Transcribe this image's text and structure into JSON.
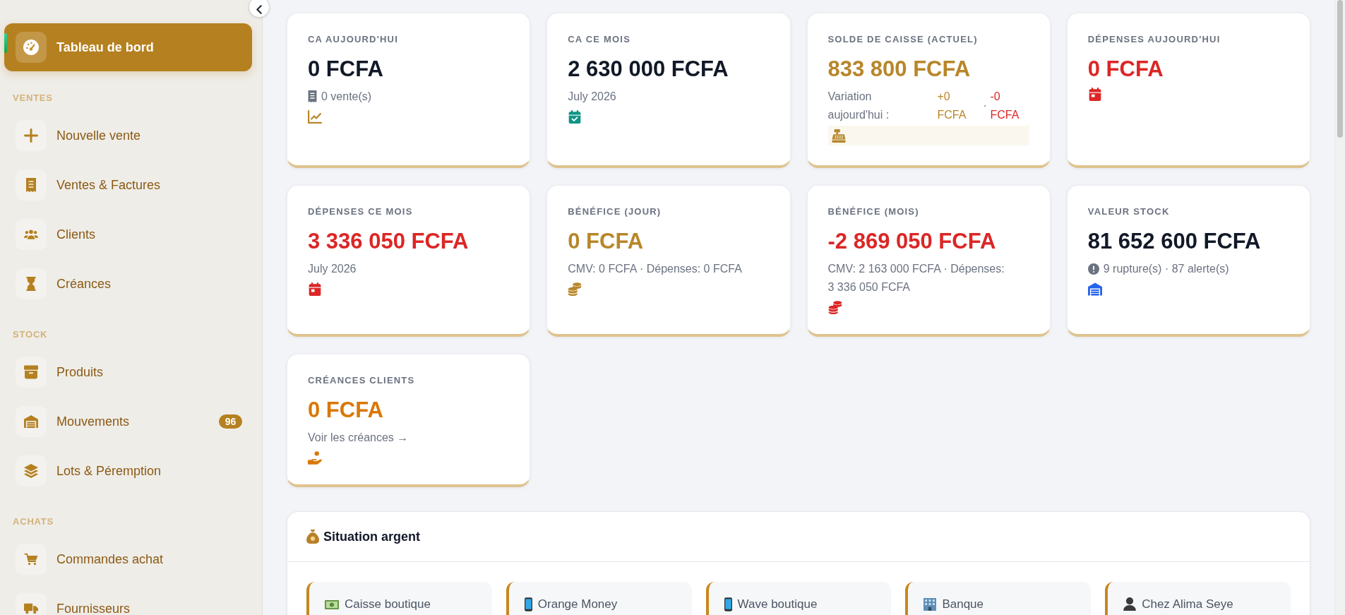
{
  "sidebar": {
    "sections": [
      {
        "items": [
          {
            "label": "Tableau de bord",
            "kind": "dashboard",
            "selected": true
          }
        ]
      },
      {
        "title": "VENTES",
        "items": [
          {
            "label": "Nouvelle vente",
            "kind": "add",
            "selected": false
          },
          {
            "label": "Ventes & Factures",
            "kind": "invoices",
            "selected": false
          },
          {
            "label": "Clients",
            "kind": "clients",
            "selected": false
          },
          {
            "label": "Créances",
            "kind": "debts",
            "selected": false
          }
        ]
      },
      {
        "title": "STOCK",
        "items": [
          {
            "label": "Produits",
            "kind": "products",
            "selected": false
          },
          {
            "label": "Mouvements",
            "kind": "movements",
            "selected": false,
            "badge": "96"
          },
          {
            "label": "Lots & Péremption",
            "kind": "batches",
            "selected": false
          }
        ]
      },
      {
        "title": "ACHATS",
        "items": [
          {
            "label": "Commandes achat",
            "kind": "orders",
            "selected": false
          },
          {
            "label": "Fournisseurs",
            "kind": "suppliers",
            "selected": false
          }
        ]
      }
    ]
  },
  "stats": [
    {
      "kind": "revenue",
      "label": "CA AUJOURD'HUI",
      "value": "0 FCFA",
      "color": "#111827",
      "note": "0 vente(s)"
    },
    {
      "kind": "period",
      "label": "CA CE MOIS",
      "value": "2 630 000 FCFA",
      "color": "#111827",
      "note": "July 2026"
    },
    {
      "kind": "cash",
      "label": "SOLDE DE CAISSE (ACTUEL)",
      "value": "833 800 FCFA",
      "color": "#b8862a",
      "variation": {
        "label": "Variation aujourd'hui :",
        "gain": "+0 FCFA",
        "separator": "·",
        "loss": "-0 FCFA"
      }
    },
    {
      "kind": "expense",
      "label": "DÉPENSES AUJOURD'HUI",
      "value": "0 FCFA",
      "color": "#dc2626"
    },
    {
      "kind": "expense",
      "label": "DÉPENSES CE MOIS",
      "value": "3 336 050 FCFA",
      "color": "#dc2626",
      "note": "July 2026"
    },
    {
      "kind": "profit",
      "label": "BÉNÉFICE (JOUR)",
      "value": "0 FCFA",
      "color": "#b8862a",
      "note": "CMV: 0 FCFA · Dépenses: 0 FCFA"
    },
    {
      "kind": "profit",
      "label": "BÉNÉFICE (MOIS)",
      "value": "-2 869 050 FCFA",
      "color": "#dc2626",
      "note": "CMV: 2 163 000 FCFA · Dépenses: 3 336 050 FCFA"
    },
    {
      "kind": "stock",
      "label": "VALEUR STOCK",
      "value": "81 652 600 FCFA",
      "color": "#111827",
      "note": "9 rupture(s) · 87 alerte(s)"
    },
    {
      "kind": "receivable",
      "label": "CRÉANCES CLIENTS",
      "value": "0 FCFA",
      "color": "#d97706",
      "link": "Voir les créances →"
    }
  ],
  "money_panel": {
    "title": "Situation argent",
    "accounts": [
      {
        "kind": "cash",
        "name": "Caisse boutique"
      },
      {
        "kind": "mobile",
        "name": "Orange Money"
      },
      {
        "kind": "mobile",
        "name": "Wave boutique"
      },
      {
        "kind": "bank",
        "name": "Banque"
      },
      {
        "kind": "person",
        "name": "Chez Alima Seye"
      }
    ]
  }
}
